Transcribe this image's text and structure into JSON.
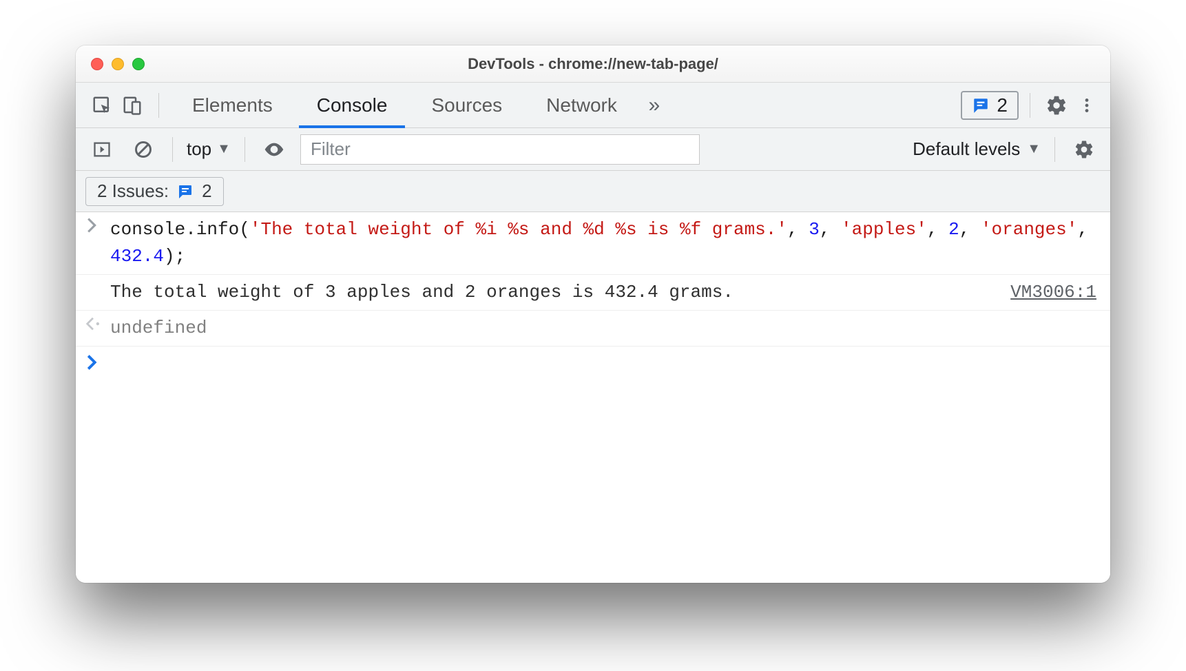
{
  "window": {
    "title": "DevTools - chrome://new-tab-page/"
  },
  "tabs": {
    "items": [
      "Elements",
      "Console",
      "Sources",
      "Network"
    ],
    "active_index": 1,
    "overflow_glyph": "»"
  },
  "issues_pill": {
    "count": "2"
  },
  "console_toolbar": {
    "context_label": "top",
    "filter_placeholder": "Filter",
    "levels_label": "Default levels"
  },
  "issues_strip": {
    "label_prefix": "2 Issues:",
    "count": "2"
  },
  "console": {
    "input": {
      "segments": [
        {
          "t": "console",
          "c": "tok-obj"
        },
        {
          "t": ".",
          "c": "tok-pun"
        },
        {
          "t": "info",
          "c": "tok-obj"
        },
        {
          "t": "(",
          "c": "tok-pun"
        },
        {
          "t": "'The total weight of %i %s and %d %s is %f grams.'",
          "c": "tok-str"
        },
        {
          "t": ", ",
          "c": "tok-pun"
        },
        {
          "t": "3",
          "c": "tok-num"
        },
        {
          "t": ", ",
          "c": "tok-pun"
        },
        {
          "t": "'apples'",
          "c": "tok-str"
        },
        {
          "t": ", ",
          "c": "tok-pun"
        },
        {
          "t": "2",
          "c": "tok-num"
        },
        {
          "t": ", ",
          "c": "tok-pun"
        },
        {
          "t": "'oranges'",
          "c": "tok-str"
        },
        {
          "t": ", ",
          "c": "tok-pun"
        },
        {
          "t": "432.4",
          "c": "tok-num"
        },
        {
          "t": ");",
          "c": "tok-pun"
        }
      ]
    },
    "output_text": "The total weight of 3 apples and 2 oranges is 432.4 grams.",
    "output_source": "VM3006:1",
    "return_value": "undefined"
  },
  "gutters": {
    "input": "›",
    "return": "‹·",
    "prompt": "›"
  }
}
